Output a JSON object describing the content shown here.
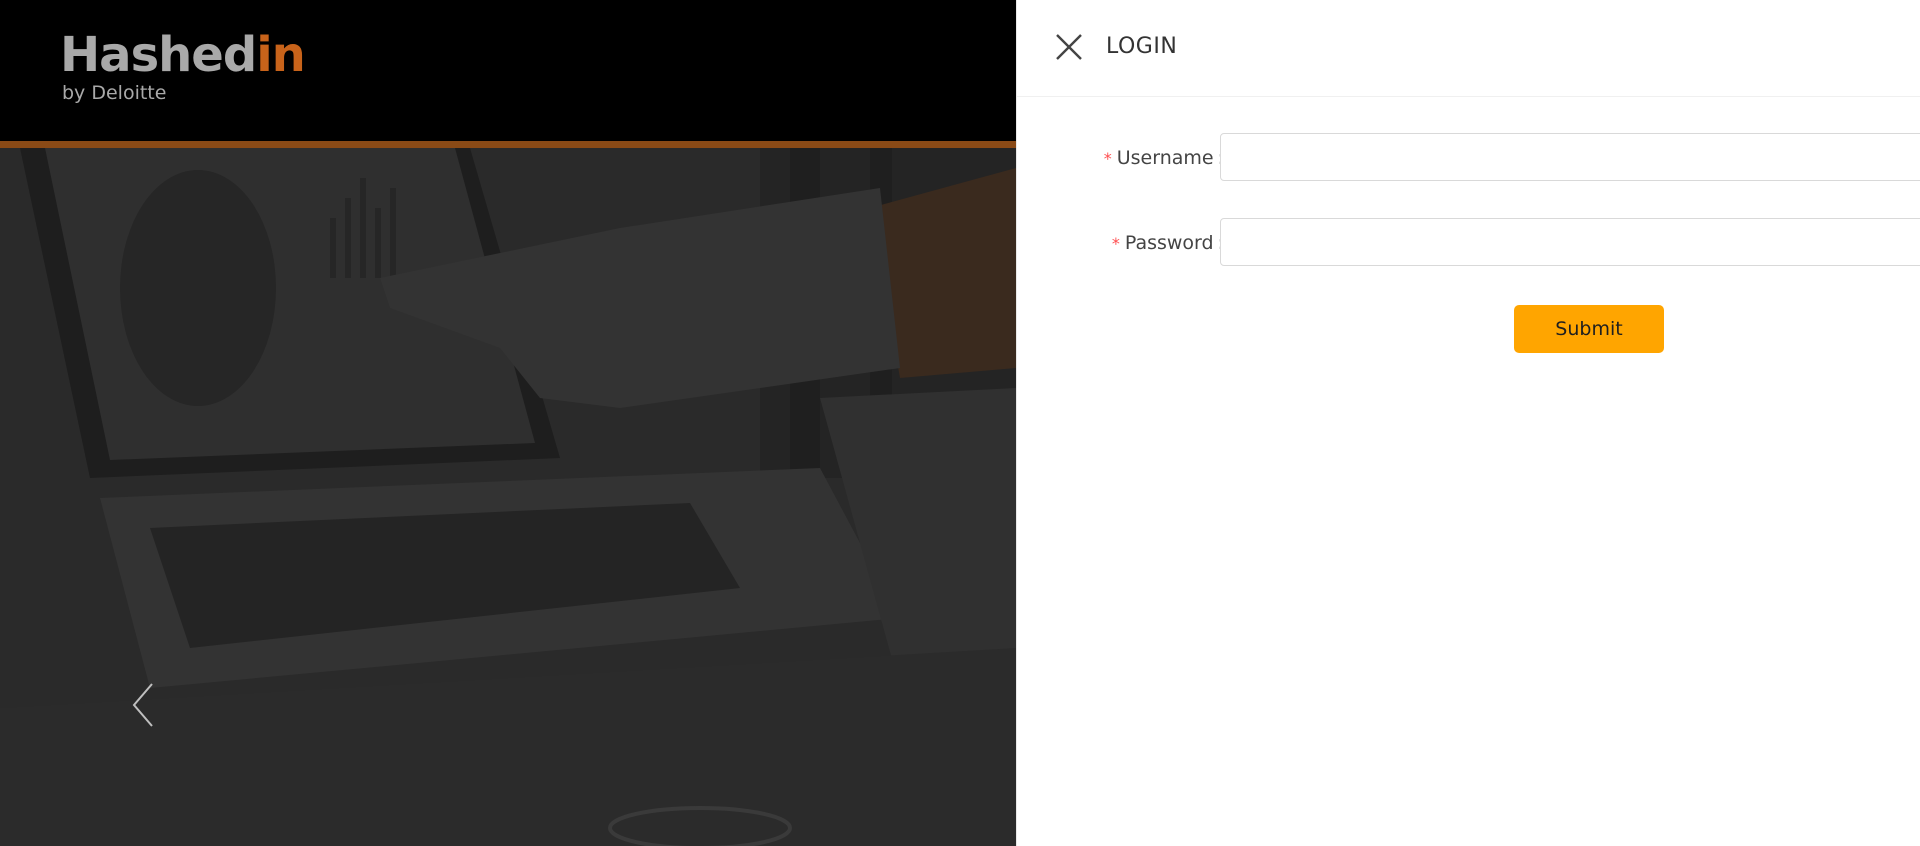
{
  "brand": {
    "logo_main": "Hashed",
    "logo_accent": "in",
    "logo_sub": "by Deloitte",
    "accent_color": "#c8631a"
  },
  "carousel": {
    "prev_icon": "chevron-left-icon"
  },
  "drawer": {
    "title": "LOGIN",
    "close_icon": "close-icon",
    "fields": {
      "username": {
        "label": "Username",
        "required_mark": "*",
        "colon": ":",
        "value": "",
        "placeholder": ""
      },
      "password": {
        "label": "Password",
        "required_mark": "*",
        "colon": ":",
        "value": "",
        "placeholder": ""
      }
    },
    "submit_label": "Submit",
    "submit_color": "#ffa500",
    "required_color": "#ff4d4f"
  }
}
